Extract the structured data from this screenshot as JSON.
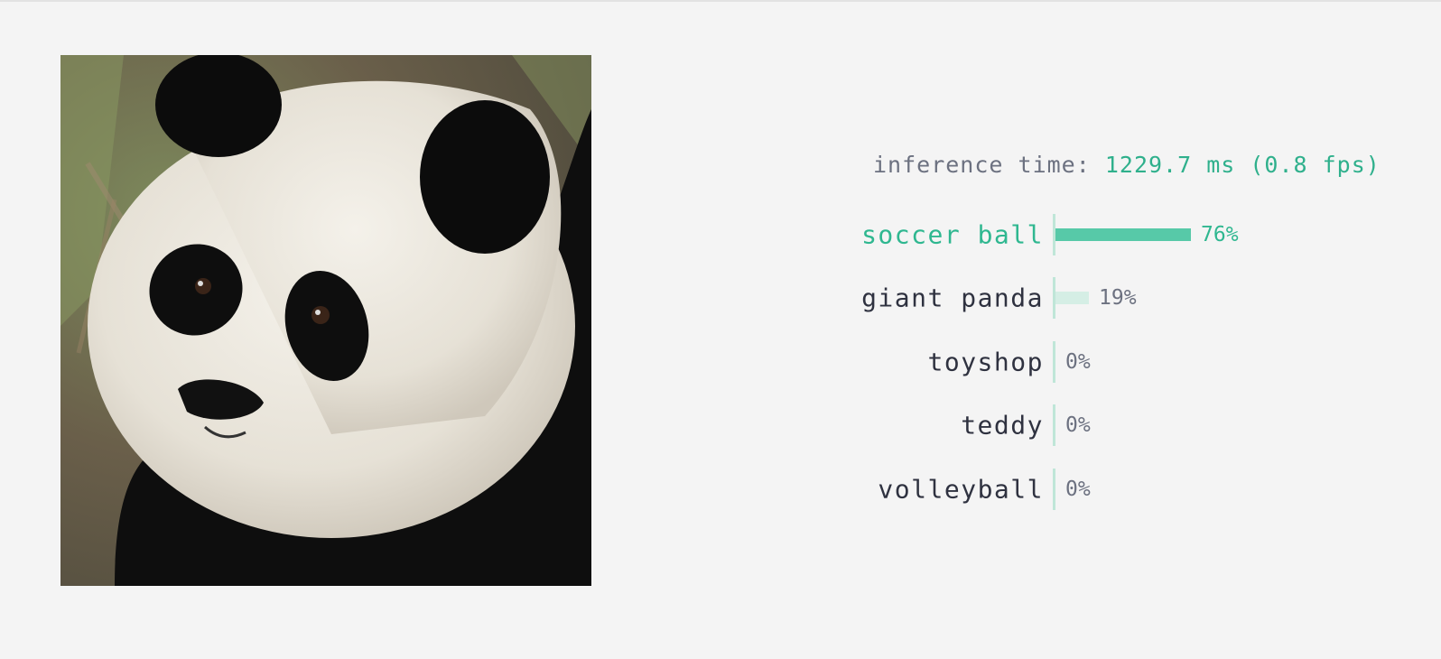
{
  "image": {
    "subject": "giant panda photo",
    "colors": {
      "background_foliage": "#6b7256",
      "fur_white": "#ece8e0",
      "fur_black": "#0d0d0d"
    }
  },
  "inference": {
    "label": "inference time:",
    "value": "1229.7 ms (0.8 fps)"
  },
  "predictions": [
    {
      "label": "soccer ball",
      "percent_text": "76%",
      "probability": 0.76,
      "top": true
    },
    {
      "label": "giant panda",
      "percent_text": "19%",
      "probability": 0.19,
      "top": false
    },
    {
      "label": "toyshop",
      "percent_text": "0%",
      "probability": 0.0,
      "top": false
    },
    {
      "label": "teddy",
      "percent_text": "0%",
      "probability": 0.0,
      "top": false
    },
    {
      "label": "volleyball",
      "percent_text": "0%",
      "probability": 0.0,
      "top": false
    }
  ],
  "colors": {
    "accent": "#2fb790",
    "bar_top": "#57c9a8",
    "bar_other": "#d5eee5",
    "axis": "#bfe6d8",
    "text": "#2f3240",
    "muted": "#6c7180",
    "background": "#f4f4f4"
  }
}
